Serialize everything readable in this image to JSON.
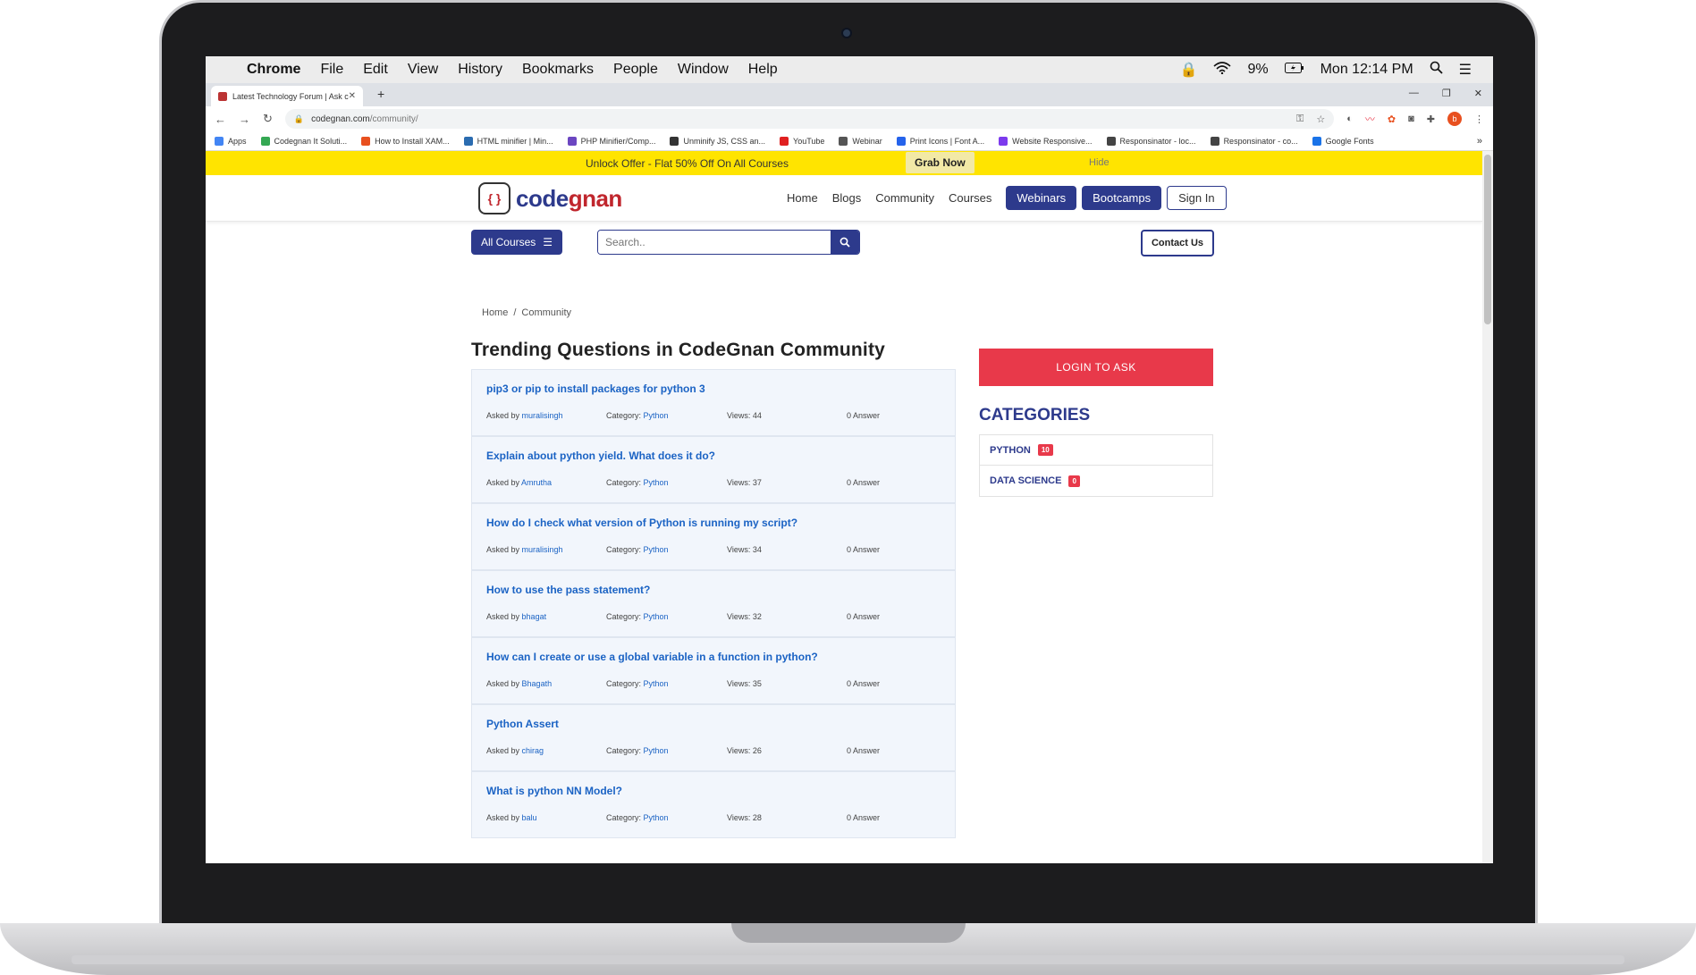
{
  "mac_menu": {
    "items": [
      "Chrome",
      "File",
      "Edit",
      "View",
      "History",
      "Bookmarks",
      "People",
      "Window",
      "Help"
    ],
    "battery": "9%",
    "clock": "Mon 12:14 PM"
  },
  "browser": {
    "tab_title": "Latest Technology Forum | Ask c",
    "url_host": "codegnan.com",
    "url_path": "/community/",
    "profile_initial": "b"
  },
  "bookmarks": [
    {
      "label": "Apps",
      "color": "#4285f4"
    },
    {
      "label": "Codegnan It Soluti...",
      "color": "#34a853"
    },
    {
      "label": "How to Install XAM...",
      "color": "#e8501f"
    },
    {
      "label": "HTML minifier | Min...",
      "color": "#2b6cb0"
    },
    {
      "label": "PHP Minifier/Comp...",
      "color": "#6b46c1"
    },
    {
      "label": "Unminify JS, CSS an...",
      "color": "#333333"
    },
    {
      "label": "YouTube",
      "color": "#e02020"
    },
    {
      "label": "Webinar",
      "color": "#555555"
    },
    {
      "label": "Print Icons | Font A...",
      "color": "#2563eb"
    },
    {
      "label": "Website Responsive...",
      "color": "#7c3aed"
    },
    {
      "label": "Responsinator - loc...",
      "color": "#444444"
    },
    {
      "label": "Responsinator - co...",
      "color": "#444444"
    },
    {
      "label": "Google Fonts",
      "color": "#1a73e8"
    }
  ],
  "offer": {
    "text": "Unlock Offer - Flat 50% Off On All Courses",
    "grab": "Grab Now",
    "hide": "Hide"
  },
  "header": {
    "logo_main": "code",
    "logo_accent": "gnan",
    "nav": {
      "home": "Home",
      "blogs": "Blogs",
      "community": "Community",
      "courses": "Courses",
      "webinars": "Webinars",
      "bootcamps": "Bootcamps",
      "signin": "Sign In"
    }
  },
  "subbar": {
    "all_courses": "All Courses",
    "search_placeholder": "Search..",
    "contact": "Contact Us"
  },
  "breadcrumb": {
    "home": "Home",
    "current": "Community",
    "sep": "/"
  },
  "main": {
    "title": "Trending Questions in CodeGnan Community",
    "asked_by_label": "Asked by",
    "category_label": "Category:",
    "views_label": "Views:",
    "answer_suffix": "Answer",
    "questions": [
      {
        "title": "pip3 or pip to install packages for python 3",
        "author": "muralisingh",
        "category": "Python",
        "views": "44",
        "answers": "0"
      },
      {
        "title": "Explain about python yield. What does it do?",
        "author": "Amrutha",
        "category": "Python",
        "views": "37",
        "answers": "0"
      },
      {
        "title": "How do I check what version of Python is running my script?",
        "author": "muralisingh",
        "category": "Python",
        "views": "34",
        "answers": "0"
      },
      {
        "title": "How to use the pass statement?",
        "author": "bhagat",
        "category": "Python",
        "views": "32",
        "answers": "0"
      },
      {
        "title": "How can I create or use a global variable in a function in python?",
        "author": "Bhagath",
        "category": "Python",
        "views": "35",
        "answers": "0"
      },
      {
        "title": "Python Assert",
        "author": "chirag",
        "category": "Python",
        "views": "26",
        "answers": "0"
      },
      {
        "title": "What is python NN Model?",
        "author": "balu",
        "category": "Python",
        "views": "28",
        "answers": "0"
      }
    ]
  },
  "sidebar": {
    "login_button": "LOGIN TO ASK",
    "categories_title": "CATEGORIES",
    "categories": [
      {
        "name": "PYTHON",
        "count": "10"
      },
      {
        "name": "DATA SCIENCE",
        "count": "0"
      }
    ]
  },
  "colors": {
    "brand_blue": "#2d3a8c",
    "brand_red": "#c0262d",
    "accent_red": "#e8394a",
    "offer_yellow": "#ffe400",
    "link_blue": "#1b63c4"
  }
}
